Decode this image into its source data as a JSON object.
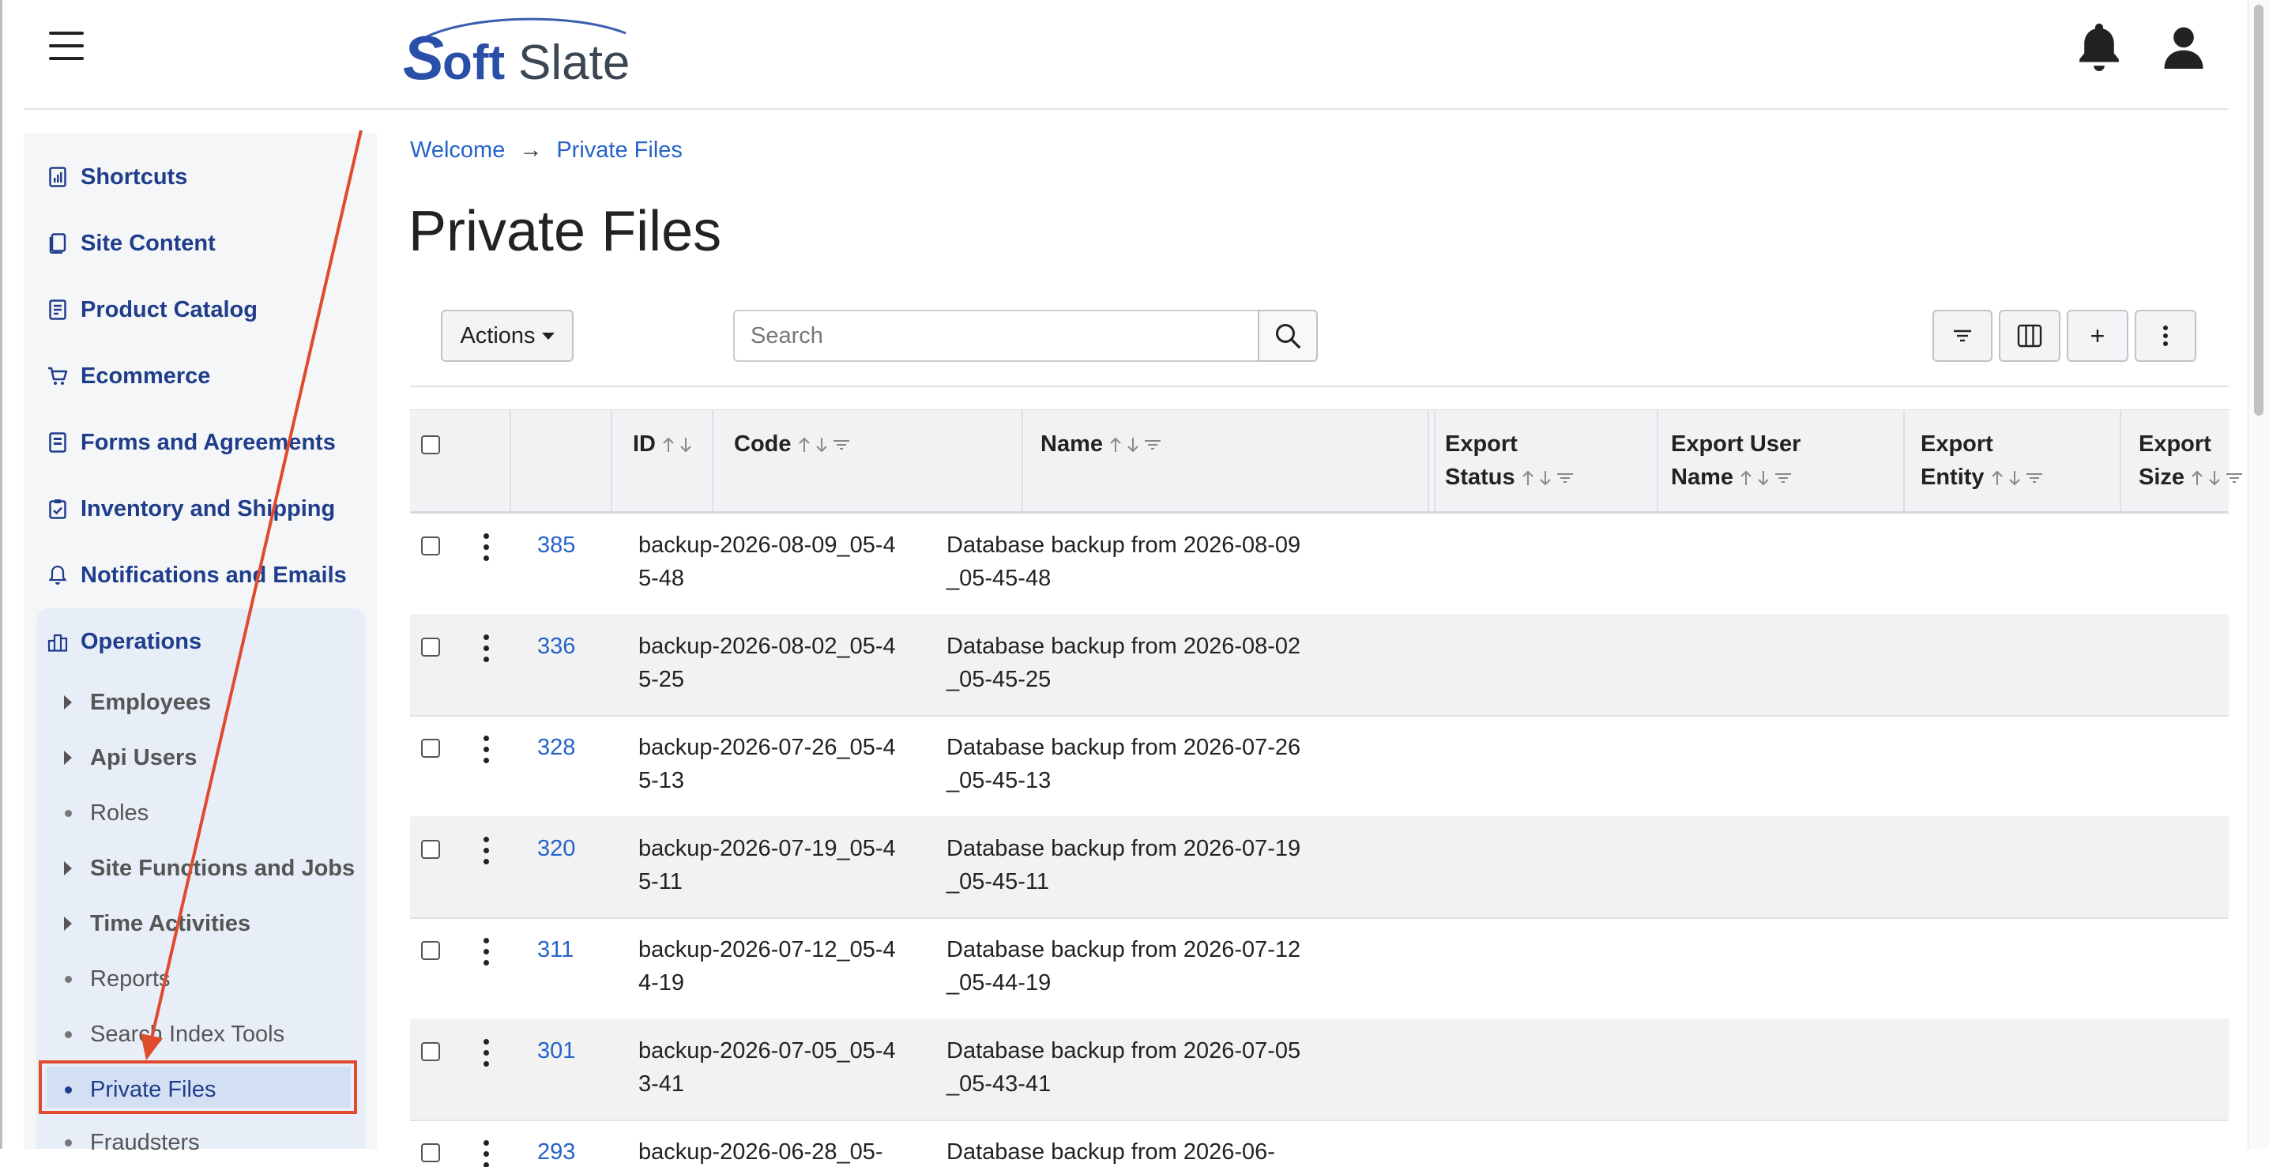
{
  "header": {
    "menu_icon": "hamburger-icon",
    "logo_text": "SoftSlate",
    "notifications_icon": "bell-icon",
    "account_icon": "user-icon"
  },
  "sidebar": {
    "items": [
      {
        "label": "Shortcuts",
        "icon": "chart-icon"
      },
      {
        "label": "Site Content",
        "icon": "pages-icon"
      },
      {
        "label": "Product Catalog",
        "icon": "catalog-icon"
      },
      {
        "label": "Ecommerce",
        "icon": "cart-icon"
      },
      {
        "label": "Forms and Agreements",
        "icon": "form-icon"
      },
      {
        "label": "Inventory and Shipping",
        "icon": "clipboard-icon"
      },
      {
        "label": "Notifications and Emails",
        "icon": "bell-icon"
      },
      {
        "label": "Operations",
        "icon": "buildings-icon"
      }
    ],
    "operations_children": [
      {
        "label": "Employees",
        "type": "expandable"
      },
      {
        "label": "Api Users",
        "type": "expandable"
      },
      {
        "label": "Roles",
        "type": "leaf"
      },
      {
        "label": "Site Functions and Jobs",
        "type": "expandable"
      },
      {
        "label": "Time Activities",
        "type": "expandable"
      },
      {
        "label": "Reports",
        "type": "leaf"
      },
      {
        "label": "Search Index Tools",
        "type": "leaf"
      },
      {
        "label": "Private Files",
        "type": "leaf",
        "active": true
      },
      {
        "label": "Fraudsters",
        "type": "leaf"
      }
    ]
  },
  "breadcrumb": {
    "home": "Welcome",
    "separator": "→",
    "current": "Private Files"
  },
  "page": {
    "title": "Private Files"
  },
  "toolbar": {
    "actions_label": "Actions",
    "search_placeholder": "Search",
    "search_value": "",
    "add_label": "+"
  },
  "table": {
    "columns": [
      {
        "line1": "ID",
        "line2": ""
      },
      {
        "line1": "Code",
        "line2": ""
      },
      {
        "line1": "Name",
        "line2": ""
      },
      {
        "line1": "Export",
        "line2": "Status"
      },
      {
        "line1": "Export User",
        "line2": "Name"
      },
      {
        "line1": "Export",
        "line2": "Entity"
      },
      {
        "line1": "Export",
        "line2": "Size"
      }
    ],
    "rows": [
      {
        "id": "385",
        "code": "backup-2026-08-09_05-45-48",
        "name": "Database backup from 2026-08-09_05-45-48"
      },
      {
        "id": "336",
        "code": "backup-2026-08-02_05-45-25",
        "name": "Database backup from 2026-08-02_05-45-25"
      },
      {
        "id": "328",
        "code": "backup-2026-07-26_05-45-13",
        "name": "Database backup from 2026-07-26_05-45-13"
      },
      {
        "id": "320",
        "code": "backup-2026-07-19_05-45-11",
        "name": "Database backup from 2026-07-19_05-45-11"
      },
      {
        "id": "311",
        "code": "backup-2026-07-12_05-44-19",
        "name": "Database backup from 2026-07-12_05-44-19"
      },
      {
        "id": "301",
        "code": "backup-2026-07-05_05-43-41",
        "name": "Database backup from 2026-07-05_05-43-41"
      },
      {
        "id": "293",
        "code": "backup-2026-06-28_05-",
        "name": "Database backup from 2026-06-"
      }
    ]
  },
  "annotation": {
    "arrow_color": "#e04a2d",
    "highlight_color": "#e04a2d"
  },
  "colors": {
    "link": "#2563c9",
    "nav_text": "#1f3d8a",
    "active_bg": "#d3e0f4"
  }
}
